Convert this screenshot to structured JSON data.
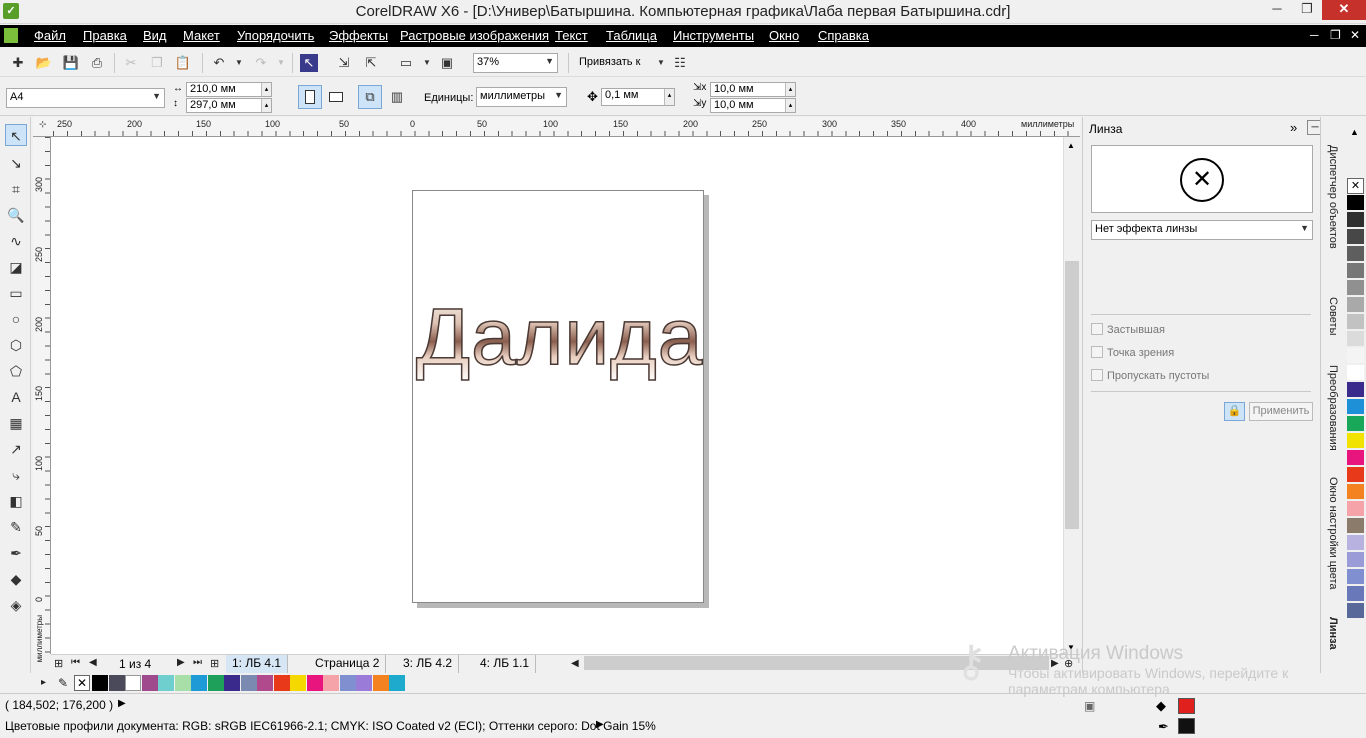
{
  "window": {
    "title": "CorelDRAW X6 - [D:\\Универ\\Батыршина. Компьютерная графика\\Лаба первая Батыршина.cdr]"
  },
  "menu": [
    "Файл",
    "Правка",
    "Вид",
    "Макет",
    "Упорядочить",
    "Эффекты",
    "Растровые изображения",
    "Текст",
    "Таблица",
    "Инструменты",
    "Окно",
    "Справка"
  ],
  "toolbar": {
    "zoom": "37%",
    "snap_label": "Привязать к"
  },
  "property_bar": {
    "page_size": "A4",
    "width": "210,0 мм",
    "height": "297,0 мм",
    "units_label": "Единицы:",
    "units_value": "миллиметры",
    "nudge": "0,1 мм",
    "dup_x": "10,0 мм",
    "dup_y": "10,0 мм"
  },
  "rulers": {
    "h_labels": [
      "250",
      "200",
      "150",
      "100",
      "50",
      "0",
      "50",
      "100",
      "150",
      "200",
      "250",
      "300",
      "350",
      "400"
    ],
    "h_unit": "миллиметры",
    "v_labels": [
      "300",
      "250",
      "200",
      "150",
      "100",
      "50",
      "0"
    ],
    "v_unit": "миллиметры"
  },
  "canvas_text": "Далида",
  "page_nav": {
    "counter": "1 из 4",
    "tabs": [
      "1: ЛБ 4.1",
      "Страница 2",
      "3: ЛБ 4.2",
      "4: ЛБ 1.1"
    ]
  },
  "docker": {
    "title": "Линза",
    "lens_effect": "Нет эффекта линзы",
    "options": [
      "Застывшая",
      "Точка зрения",
      "Пропускать пустоты"
    ],
    "apply": "Применить",
    "side_tabs": [
      "Диспетчер объектов",
      "Советы",
      "Преобразования",
      "Окно настройки цвета",
      "Линза"
    ]
  },
  "status": {
    "coords": "( 184,502; 176,200 )",
    "profiles": "Цветовые профили документа: RGB: sRGB IEC61966-2.1; CMYK: ISO Coated v2 (ECI); Оттенки серого: Dot Gain 15%",
    "fill_color": "#e0201c",
    "outline_color": "#111111"
  },
  "palette_colors": [
    "#000000",
    "#2e2e2e",
    "#474747",
    "#5e5e5e",
    "#777777",
    "#909090",
    "#a9a9a9",
    "#c2c2c2",
    "#dbdbdb",
    "#f4f4f4",
    "#ffffff",
    "#3a2a8c",
    "#1e90d8",
    "#19a85a",
    "#f2e200",
    "#e8157e",
    "#e83a1a",
    "#f58220",
    "#f5a3a8",
    "#8b7b6a",
    "#b7b2e0",
    "#9b9bd8",
    "#7f8fd0",
    "#6878b8",
    "#586898"
  ],
  "hpalette_colors": [
    "#000000",
    "#4a4a5a",
    "#ffffff",
    "#9e4a8c",
    "#6fcfcf",
    "#a8dfa8",
    "#1e9ad6",
    "#1ea05a",
    "#3a2a8c",
    "#7a8ab0",
    "#b04a8c",
    "#e83a1a",
    "#f5d800",
    "#e8157e",
    "#f5a3a8",
    "#7f8fd0",
    "#9b7bd8",
    "#f58220",
    "#1eaacc"
  ],
  "watermark": {
    "line1": "Активация Windows",
    "line2": "Чтобы активировать Windows, перейдите к",
    "line3": "параметрам компьютера"
  }
}
